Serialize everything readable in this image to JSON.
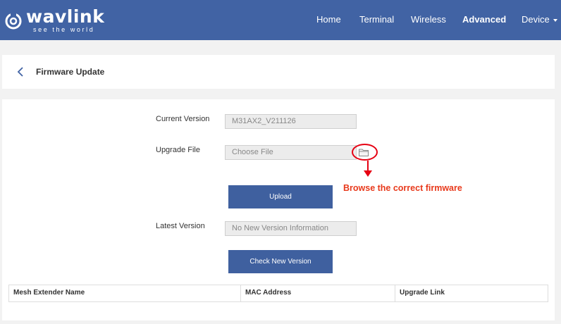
{
  "header": {
    "logo_text": "wavlink",
    "logo_tagline": "see the world",
    "nav": [
      {
        "label": "Home"
      },
      {
        "label": "Terminal"
      },
      {
        "label": "Wireless"
      },
      {
        "label": "Advanced",
        "active": true
      },
      {
        "label": "Device"
      }
    ],
    "colors": {
      "header_bg": "#4163a4"
    }
  },
  "page": {
    "title": "Firmware Update",
    "back_icon": "chevron-left-icon"
  },
  "form": {
    "current_version_label": "Current Version",
    "current_version_value": "M31AX2_V211126",
    "upgrade_file_label": "Upgrade File",
    "upgrade_file_placeholder": "Choose File",
    "browse_icon": "folder-icon",
    "upload_label": "Upload",
    "latest_version_label": "Latest Version",
    "latest_version_value": "No New Version Information",
    "check_label": "Check New Version"
  },
  "annotation": {
    "text": "Browse the correct firmware",
    "color": "#e8391b"
  },
  "mesh_table": {
    "columns": [
      "Mesh Extender Name",
      "MAC Address",
      "Upgrade Link"
    ],
    "rows": []
  }
}
